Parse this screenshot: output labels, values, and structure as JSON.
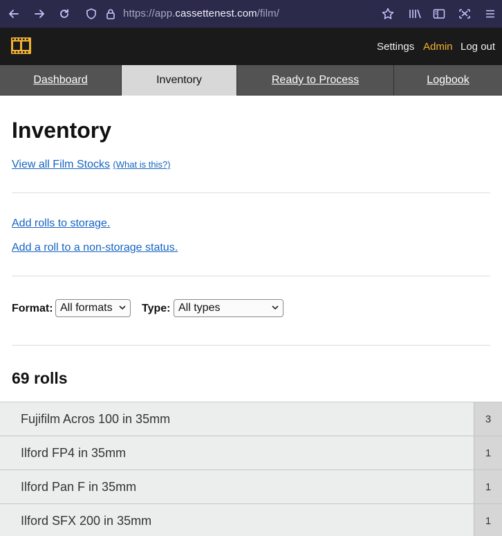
{
  "browser": {
    "url_prefix": "https://app.",
    "url_host": "cassettenest.com",
    "url_path": "/film/"
  },
  "header": {
    "links": [
      "Settings",
      "Admin",
      "Log out"
    ]
  },
  "tabs": [
    {
      "label": "Dashboard"
    },
    {
      "label": "Inventory"
    },
    {
      "label": "Ready to Process"
    },
    {
      "label": "Logbook"
    }
  ],
  "main": {
    "title": "Inventory",
    "view_stocks_label": "View all Film Stocks",
    "what_is_this_label": "(What is this?)",
    "add_storage_label": "Add rolls to storage.",
    "add_status_label": "Add a roll to a non-storage status.",
    "filters": {
      "format_label": "Format:",
      "format_value": "All formats",
      "type_label": "Type:",
      "type_value": "All types"
    },
    "count_label": "69 rolls",
    "rolls": [
      {
        "name": "Fujifilm Acros 100 in 35mm",
        "count": "3"
      },
      {
        "name": "Ilford FP4 in 35mm",
        "count": "1"
      },
      {
        "name": "Ilford Pan F in 35mm",
        "count": "1"
      },
      {
        "name": "Ilford SFX 200 in 35mm",
        "count": "1"
      }
    ]
  },
  "colors": {
    "browser_bg": "#2b2a4a",
    "header_bg": "#1a1a1a",
    "admin_link": "#f3b233",
    "logo": "#f3b233",
    "link": "#1463c1"
  }
}
